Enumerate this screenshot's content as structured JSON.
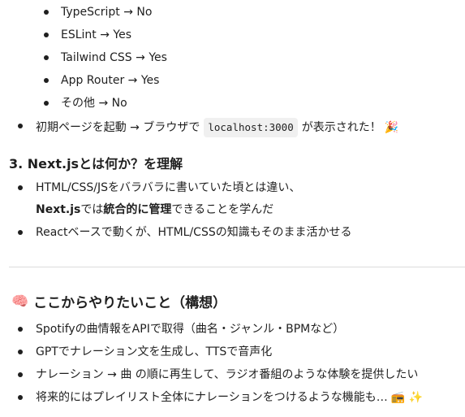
{
  "sub_list": [
    "TypeScript → No",
    "ESLint → Yes",
    "Tailwind CSS → Yes",
    "App Router → Yes",
    "その他 → No"
  ],
  "startup_item": {
    "prefix": "初期ページを起動 → ブラウザで",
    "code": "localhost:3000",
    "suffix": "が表示された！",
    "emoji": "🎉"
  },
  "section3": {
    "heading": "3. Next.jsとは何か？を理解",
    "item1_line1": "HTML/CSS/JSをバラバラに書いていた頃とは違い、",
    "item1_line2_bold1": "Next.js",
    "item1_line2_text1": "では",
    "item1_line2_bold2": "統合的に管理",
    "item1_line2_text2": "できることを学んだ",
    "item2": "Reactベースで動くが、HTML/CSSの知識もそのまま活かせる"
  },
  "plans": {
    "icon": "🧠",
    "heading": "ここからやりたいこと（構想）",
    "items": [
      "Spotifyの曲情報をAPIで取得（曲名・ジャンル・BPMなど）",
      "GPTでナレーション文を生成し、TTSで音声化",
      "ナレーション → 曲 の順に再生して、ラジオ番組のような体験を提供したい",
      "将来的にはプレイリスト全体にナレーションをつけるような機能も…"
    ],
    "last_item_emojis": "📻 ✨"
  }
}
